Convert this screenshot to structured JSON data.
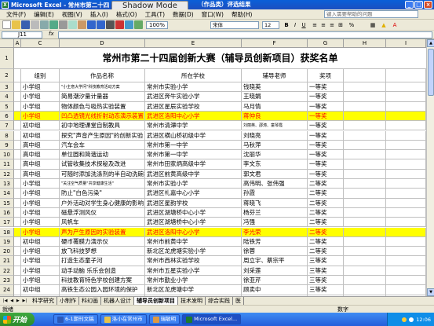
{
  "app": {
    "title": "Microsoft Excel - 常州市第二十四",
    "title_suffix": "（作品类）评选结果",
    "shadow_mode_label": "Shadow Mode"
  },
  "menu": {
    "items": [
      "文件(F)",
      "编辑(E)",
      "视图(V)",
      "插入(I)",
      "格式(O)",
      "工具(T)",
      "数据(D)",
      "窗口(W)",
      "帮助(H)"
    ],
    "help_placeholder": "键入需要帮助的问题"
  },
  "toolbar": {
    "font_name": "宋体",
    "font_size": "12",
    "bold": "B",
    "italic": "I",
    "underline": "U",
    "zoom": "100%"
  },
  "formula": {
    "cell_ref": "J11",
    "fx_label": "fx",
    "value": ""
  },
  "columns": [
    "A",
    "C",
    "D",
    "E",
    "F",
    "G",
    "H",
    "I"
  ],
  "sheet": {
    "title": "常州市第二十四届创新大赛（辅导员创新项目）获奖名单",
    "headers": [
      "组别",
      "作品名称",
      "所在学校",
      "辅导老师",
      "奖项"
    ],
    "rows": [
      {
        "n": "3",
        "group": "小学组",
        "name": "\"小主意大学问\"科技教育活动方案",
        "school": "常州市实验小学",
        "teacher": "钱晓英",
        "award": "一等奖",
        "hl": false,
        "small": true
      },
      {
        "n": "4",
        "group": "小学组",
        "name": "简易潮汐量计量器",
        "school": "武进区奔牛实验小学",
        "teacher": "王晓娟",
        "award": "一等奖",
        "hl": false
      },
      {
        "n": "5",
        "group": "小学组",
        "name": "物体颜色与吸热实验装置",
        "school": "武进区星辰实验学校",
        "teacher": "马月情",
        "award": "一等奖",
        "hl": false
      },
      {
        "n": "6",
        "group": "小学组",
        "name": "凹凸透镜光线折射动态演示装置",
        "school": "武进区洛阳中心小学",
        "teacher": "蒋仲良",
        "award": "一等奖",
        "hl": true
      },
      {
        "n": "7",
        "group": "初中组",
        "name": "初中地理课堂自制教具",
        "school": "常州市清潭中学",
        "teacher": "刘丽英、邵涛、童琴霞",
        "award": "一等奖",
        "hl": false,
        "small_teacher": true
      },
      {
        "n": "8",
        "group": "初中组",
        "name": "探究\"声音产生原因\"的创新实验",
        "school": "武进区横山桥初级中学",
        "teacher": "刘晓亮",
        "award": "一等奖",
        "hl": false
      },
      {
        "n": "9",
        "group": "高中组",
        "name": "汽车会车",
        "school": "常州市第一中学",
        "teacher": "马秋萍",
        "award": "一等奖",
        "hl": false
      },
      {
        "n": "10",
        "group": "高中组",
        "name": "单位圆和简谐运动",
        "school": "常州市第一中学",
        "teacher": "沈丽华",
        "award": "一等奖",
        "hl": false
      },
      {
        "n": "11",
        "group": "高中组",
        "name": "试管收集技术探秘及改进",
        "school": "常州市田家炳高级中学",
        "teacher": "李文东",
        "award": "一等奖",
        "hl": false
      },
      {
        "n": "12",
        "group": "高中组",
        "name": "可随时添加洗涤剂的半自动洗碗机",
        "school": "武进区前黄高级中学",
        "teacher": "郭文君",
        "award": "一等奖",
        "hl": false
      },
      {
        "n": "13",
        "group": "小学组",
        "name": "\"关注空气质量\"共享健康生活\"",
        "school": "常州市实验小学",
        "teacher": "高伟明、张伟强",
        "award": "二等奖",
        "hl": false,
        "small": true
      },
      {
        "n": "14",
        "group": "小学组",
        "name": "防止\"白色污染\"",
        "school": "武进区礼嘉中心小学",
        "teacher": "孙霞",
        "award": "二等奖",
        "hl": false
      },
      {
        "n": "15",
        "group": "小学组",
        "name": "户外活动对学生身心健康的影响",
        "school": "武进区星韵学校",
        "teacher": "蒋晓飞",
        "award": "二等奖",
        "hl": false
      },
      {
        "n": "16",
        "group": "小学组",
        "name": "磁悬浮测风仪",
        "school": "武进区湖塘桥中心小学",
        "teacher": "杨芬兰",
        "award": "二等奖",
        "hl": false
      },
      {
        "n": "17",
        "group": "小学组",
        "name": "风帆车",
        "school": "武进区湖塘桥中心小学",
        "teacher": "冯强",
        "award": "二等奖",
        "hl": false
      },
      {
        "n": "18",
        "group": "小学组",
        "name": "声为产生原因的实验装置",
        "school": "武进区洛阳中心小学",
        "teacher": "李光荣",
        "award": "二等奖",
        "hl": true
      },
      {
        "n": "19",
        "group": "初中组",
        "name": "硬币覆膜力演示仪",
        "school": "常州市前黄中学",
        "teacher": "陆铁芳",
        "award": "二等奖",
        "hl": false
      },
      {
        "n": "20",
        "group": "小学组",
        "name": "放飞科技梦想",
        "school": "新北区龙虎塘实验小学",
        "teacher": "徐蓉",
        "award": "二等奖",
        "hl": false
      },
      {
        "n": "21",
        "group": "小学组",
        "name": "打造生态童子河",
        "school": "常州市西林实验学校",
        "teacher": "周立宇、蔡宗平",
        "award": "三等奖",
        "hl": false
      },
      {
        "n": "22",
        "group": "小学组",
        "name": "动手动脑 乐乐会创造",
        "school": "常州市五星实验小学",
        "teacher": "刘采莲",
        "award": "三等奖",
        "hl": false
      },
      {
        "n": "23",
        "group": "小学组",
        "name": "科技教育特色学校创建方案",
        "school": "常州市勤业小学",
        "teacher": "徐亚芹",
        "award": "三等奖",
        "hl": false
      },
      {
        "n": "24",
        "group": "初中组",
        "name": "高铁生态公园入园环境的保护",
        "school": "新北区龙虎塘中学",
        "teacher": "顾卖中",
        "award": "三等奖",
        "hl": false
      },
      {
        "n": "25",
        "group": "高中组",
        "name": "第五届校园科技节",
        "school": "常州市北郊高级中学",
        "teacher": "孙雪娟",
        "award": "三等奖",
        "hl": false
      }
    ]
  },
  "tabs": {
    "items": [
      "科学研究",
      "小制作",
      "科幻画",
      "机器人设计",
      "辅导员创新项目",
      "技术发明",
      "综合实践",
      "医"
    ],
    "active_index": 4
  },
  "status": {
    "ready": "就绪",
    "num": "数字"
  },
  "taskbar": {
    "start_label": "开始",
    "tasks": [
      "6-1期刊文稿",
      "洛小在常州市",
      "瑞敏明",
      "Microsoft Excel..."
    ],
    "clock": "12:06"
  }
}
